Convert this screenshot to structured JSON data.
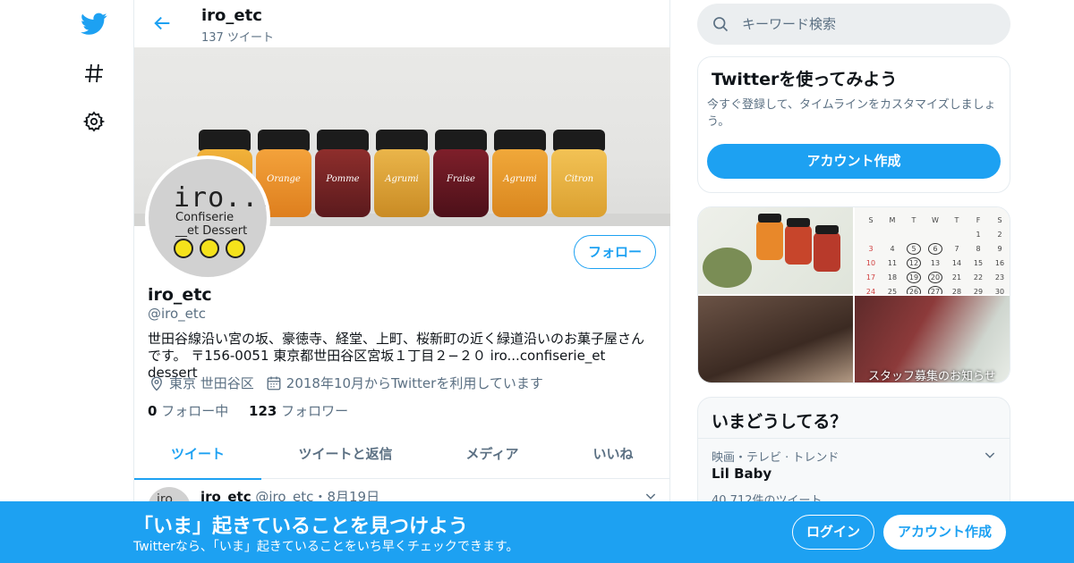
{
  "nav": {
    "logo_icon": "twitter-bird-icon",
    "explore_icon": "hashtag-icon",
    "settings_icon": "gear-icon"
  },
  "colors": {
    "accent": "#1da1f2",
    "text": "#0f1419",
    "muted": "#5b7083"
  },
  "header": {
    "back_icon": "arrow-left-icon",
    "title": "iro_etc",
    "tweet_count": "137 ツイート"
  },
  "banner": {
    "jar_labels": [
      "",
      "Orange",
      "Pomme",
      "Agrumi",
      "Fraise",
      "Agrumi",
      "Citron"
    ]
  },
  "avatar": {
    "line1": "iro...",
    "line2": "Confiserie",
    "line3": "__et Dessert"
  },
  "profile": {
    "follow_label": "フォロー",
    "name": "iro_etc",
    "handle": "@iro_etc",
    "bio_line1": "世田谷線沿い宮の坂、豪徳寺、経堂、上町、桜新町の近く緑道沿いのお菓子屋さん",
    "bio_line2": "です。 〒156-0051 東京都世田谷区宮坂１丁目２−２０ iro...confiserie_et dessert",
    "location_icon": "location-pin-icon",
    "location": "東京 世田谷区",
    "joined_icon": "calendar-icon",
    "joined": "2018年10月からTwitterを利用しています",
    "following_count": "0",
    "following_label": "フォロー中",
    "followers_count": "123",
    "followers_label": "フォロワー"
  },
  "tabs": [
    {
      "label": "ツイート",
      "active": true
    },
    {
      "label": "ツイートと返信",
      "active": false
    },
    {
      "label": "メディア",
      "active": false
    },
    {
      "label": "いいね",
      "active": false
    }
  ],
  "tweet": {
    "avatar_text": "iro",
    "name": "iro_etc",
    "handle": "@iro_etc",
    "sep": "・",
    "date": "8月19日",
    "more_icon": "chevron-down-icon"
  },
  "search": {
    "placeholder": "キーワード検索",
    "icon": "search-icon"
  },
  "signup_card": {
    "title": "Twitterを使ってみよう",
    "desc": "今すぐ登録して、タイムラインをカスタマイズしましょう。",
    "button": "アカウント作成"
  },
  "media_card": {
    "calendar": {
      "weekdays": [
        "S",
        "M",
        "T",
        "W",
        "T",
        "F",
        "S"
      ],
      "rows": [
        [
          "",
          "",
          "",
          "",
          "",
          "1",
          "2"
        ],
        [
          "3",
          "4",
          "5",
          "6",
          "7",
          "8",
          "9"
        ],
        [
          "10",
          "11",
          "12",
          "13",
          "14",
          "15",
          "16"
        ],
        [
          "17",
          "18",
          "19",
          "20",
          "21",
          "22",
          "23"
        ],
        [
          "24",
          "25",
          "26",
          "27",
          "28",
          "29",
          "30"
        ]
      ]
    },
    "caption": "スタッフ募集のお知らせ"
  },
  "trends": {
    "title": "いまどうしてる？",
    "category": "映画・テレビ · トレンド",
    "name": "Lil Baby",
    "count": "40,712件のツイート",
    "more_icon": "chevron-down-icon"
  },
  "bottom_bar": {
    "title": "「いま」起きていることを見つけよう",
    "subtitle": "Twitterなら、「いま」起きていることをいち早くチェックできます。",
    "login": "ログイン",
    "signup": "アカウント作成"
  }
}
